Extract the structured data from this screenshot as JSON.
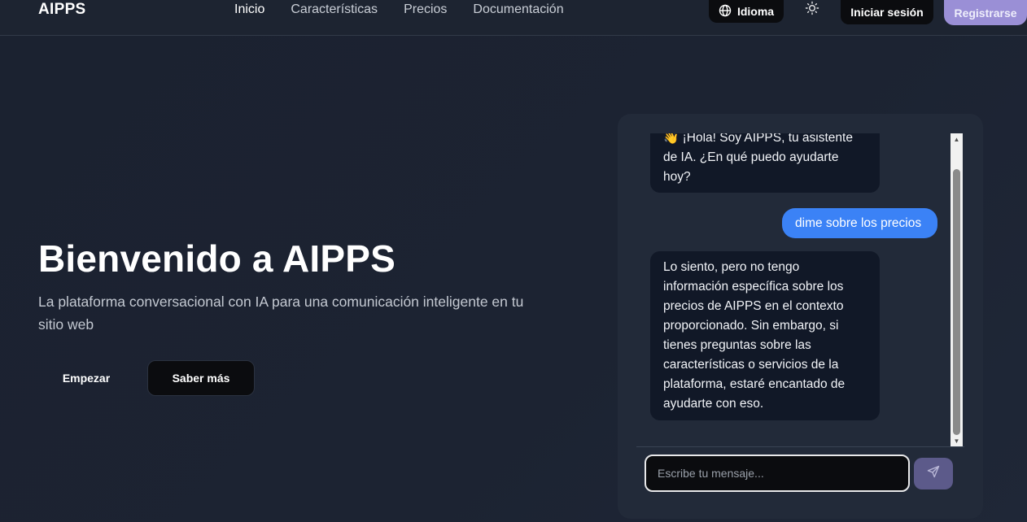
{
  "navbar": {
    "brand": "AIPPS",
    "links": [
      {
        "label": "Inicio",
        "active": true
      },
      {
        "label": "Características",
        "active": false
      },
      {
        "label": "Precios",
        "active": false
      },
      {
        "label": "Documentación",
        "active": false
      }
    ],
    "language_label": "Idioma",
    "language_icon": "globe-icon",
    "theme_icon": "sun-icon",
    "login_label": "Iniciar sesión",
    "register_label": "Registrarse"
  },
  "hero": {
    "title": "Bienvenido a AIPPS",
    "subtitle": "La plataforma conversacional con IA para una comunicación inteligente en tu sitio web",
    "start_label": "Empezar",
    "more_label": "Saber más"
  },
  "chat": {
    "messages": [
      {
        "role": "bot",
        "text": "👋 ¡Hola! Soy AIPPS, tu asistente de IA. ¿En qué puedo ayudarte hoy?"
      },
      {
        "role": "user",
        "text": "dime sobre los precios"
      },
      {
        "role": "bot",
        "text": "Lo siento, pero no tengo información específica sobre los precios de AIPPS en el contexto proporcionado. Sin embargo, si tienes preguntas sobre las características o servicios de la plataforma, estaré encantado de ayudarte con eso."
      }
    ],
    "input_placeholder": "Escribe tu mensaje...",
    "send_icon": "send-icon"
  },
  "colors": {
    "background": "#1c2332",
    "accent": "#9a8fd6",
    "user_bubble": "#3b82f6",
    "bot_bubble": "#111827",
    "panel": "#222a39"
  }
}
